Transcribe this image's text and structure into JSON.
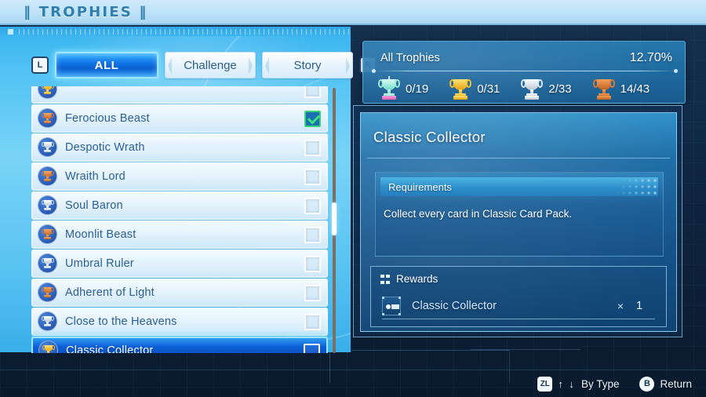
{
  "window": {
    "title": "‖ TROPHIES ‖"
  },
  "tabs": {
    "left_key": "L",
    "right_key": "R",
    "items": [
      {
        "label": "ALL",
        "active": true
      },
      {
        "label": "Challenge",
        "active": false
      },
      {
        "label": "Story",
        "active": false
      }
    ]
  },
  "list": {
    "rows": [
      {
        "name": "Ferocious Beast",
        "medal": "bronze",
        "checked": true,
        "selected": false
      },
      {
        "name": "Despotic Wrath",
        "medal": "silver",
        "checked": false,
        "selected": false
      },
      {
        "name": "Wraith Lord",
        "medal": "bronze",
        "checked": false,
        "selected": false
      },
      {
        "name": "Soul Baron",
        "medal": "silver",
        "checked": false,
        "selected": false
      },
      {
        "name": "Moonlit Beast",
        "medal": "bronze",
        "checked": false,
        "selected": false
      },
      {
        "name": "Umbral Ruler",
        "medal": "silver",
        "checked": false,
        "selected": false
      },
      {
        "name": "Adherent of Light",
        "medal": "bronze",
        "checked": false,
        "selected": false
      },
      {
        "name": "Close to the Heavens",
        "medal": "silver",
        "checked": false,
        "selected": false
      },
      {
        "name": "Classic Collector",
        "medal": "gold",
        "checked": false,
        "selected": true
      }
    ]
  },
  "summary": {
    "title": "All Trophies",
    "percent": "12.70%",
    "counters": [
      {
        "medal": "platinum",
        "count": "0/19"
      },
      {
        "medal": "gold",
        "count": "0/31"
      },
      {
        "medal": "silver",
        "count": "2/33"
      },
      {
        "medal": "bronze",
        "count": "14/43"
      }
    ]
  },
  "detail": {
    "title": "Classic Collector",
    "requirements_label": "Requirements",
    "requirements_text": "Collect every card in Classic Card Pack.",
    "rewards_label": "Rewards",
    "reward": {
      "name": "Classic Collector",
      "multiplier": "×",
      "quantity": "1"
    }
  },
  "footer": {
    "hints": [
      {
        "key": "ZL",
        "key_shape": "square",
        "arrows": "↑ ↓",
        "label": "By Type"
      },
      {
        "key": "B",
        "key_shape": "round",
        "arrows": "",
        "label": "Return"
      }
    ]
  },
  "colors": {
    "accent_blue": "#0d5fd6",
    "glow_cyan": "#9fe6ff",
    "panel_blue": "#1f6ea8",
    "check_green": "#3ee27f"
  }
}
